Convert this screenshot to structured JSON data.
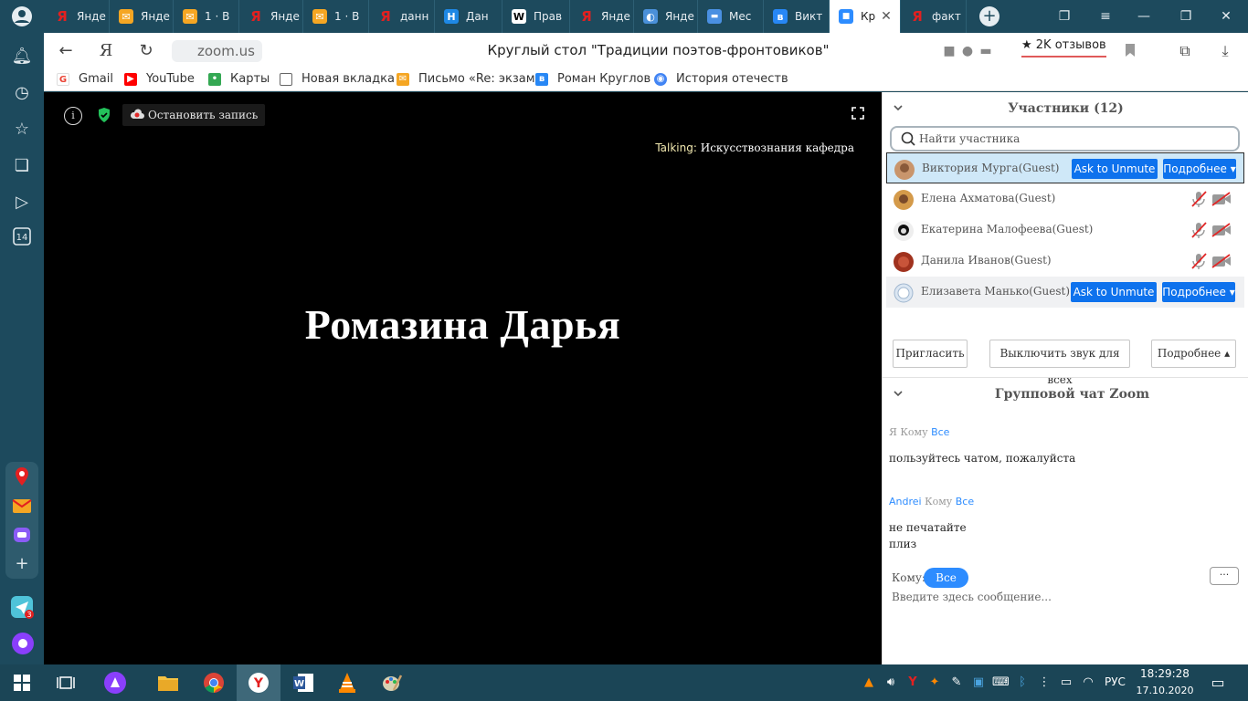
{
  "tabs": [
    {
      "label": "Янде",
      "icon": "yandex-icon",
      "color": "#e32020"
    },
    {
      "label": "Янде",
      "icon": "mail-icon",
      "color": "#f5a623"
    },
    {
      "label": "1 · В",
      "icon": "mail-icon",
      "color": "#f5a623"
    },
    {
      "label": "Янде",
      "icon": "yandex-icon",
      "color": "#e32020"
    },
    {
      "label": "1 · В",
      "icon": "mail-icon",
      "color": "#f5a623"
    },
    {
      "label": "данн",
      "icon": "yandex-icon",
      "color": "#e32020"
    },
    {
      "label": "Дан",
      "icon": "h-icon",
      "color": "#1e88e5"
    },
    {
      "label": "Прав",
      "icon": "wikipedia-icon",
      "color": "#ffffff"
    },
    {
      "label": "Янде",
      "icon": "yandex-icon",
      "color": "#e32020"
    },
    {
      "label": "Янде",
      "icon": "yandex-zen-icon",
      "color": "#4a90d9"
    },
    {
      "label": "Мес",
      "icon": "messenger-icon",
      "color": "#4a90e2"
    },
    {
      "label": "Викт",
      "icon": "vk-icon",
      "color": "#2787f5"
    },
    {
      "label": "Кр",
      "icon": "zoom-icon",
      "color": "#2d8cff",
      "active": true
    },
    {
      "label": "факт",
      "icon": "yandex-icon",
      "color": "#e32020"
    }
  ],
  "address": {
    "url": "zoom.us",
    "page_title": "Круглый стол \"Традиции поэтов-фронтовиков\"",
    "reviews": "★ 2K отзывов"
  },
  "bookmarks": [
    {
      "label": "Gmail",
      "icon": "gmail-icon"
    },
    {
      "label": "YouTube",
      "icon": "youtube-icon"
    },
    {
      "label": "Карты",
      "icon": "maps-icon"
    },
    {
      "label": "Новая вкладка",
      "icon": "page-icon"
    },
    {
      "label": "Письмо «Re: экзам",
      "icon": "mail-icon"
    },
    {
      "label": "Роман Круглов",
      "icon": "vk-icon"
    },
    {
      "label": "История отечеств",
      "icon": "history-icon"
    }
  ],
  "video": {
    "record_label": "Остановить запись",
    "talking_label": "Talking:",
    "talking_name": "Искусствознания кафедра",
    "speaker_name": "Ромазина Дарья"
  },
  "participants": {
    "title": "Участники (12)",
    "search_placeholder": "Найти участника",
    "ask_unmute": "Ask to Unmute",
    "more": "Подробнее ▾",
    "list": [
      {
        "name": "Виктория Мурга(Guest)"
      },
      {
        "name": "Елена Ахматова(Guest)"
      },
      {
        "name": "Екатерина Малофеева(Guest)"
      },
      {
        "name": "Данила Иванов(Guest)"
      },
      {
        "name": "Елизавета Манько(Guest)"
      }
    ],
    "invite": "Пригласить",
    "mute_all": "Выключить звук для всех",
    "more_bottom": "Подробнее ▴"
  },
  "chat": {
    "title": "Групповой чат Zoom",
    "messages": [
      {
        "from": "Я",
        "to_label": "Кому",
        "to": "Все",
        "lines": [
          "пользуйтесь чатом, пожалуйста"
        ]
      },
      {
        "from": "Andrei",
        "to_label": "Кому",
        "to": "Все",
        "lines": [
          "не печатайте",
          "плиз"
        ]
      }
    ],
    "to_label": "Кому:",
    "to_value": "Все",
    "more": "···",
    "input_placeholder": "Введите здесь сообщение..."
  },
  "taskbar": {
    "lang": "РУС",
    "time": "18:29:28",
    "date": "17.10.2020"
  },
  "sidebar": {
    "badge": "14",
    "messenger_badge": "3"
  }
}
